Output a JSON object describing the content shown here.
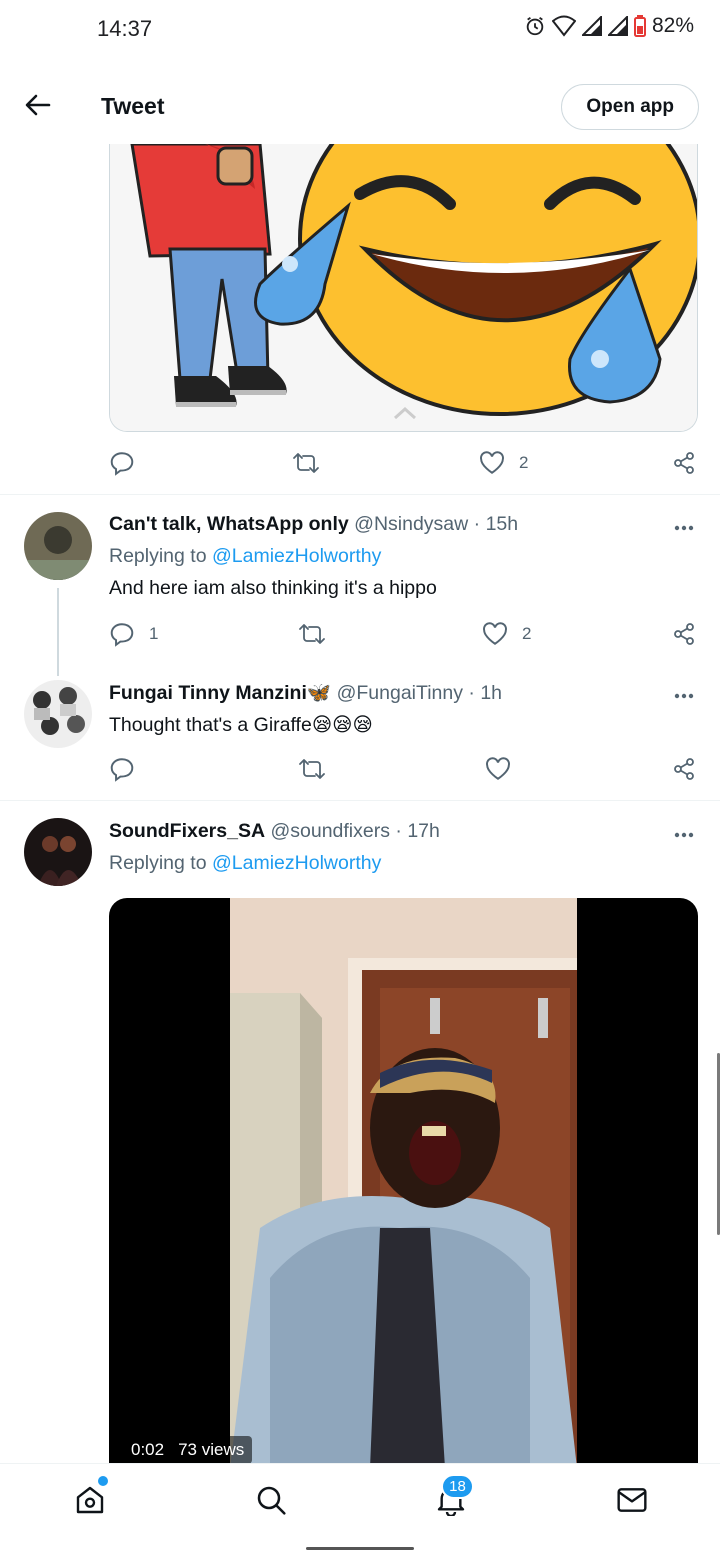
{
  "status_bar": {
    "time": "14:37",
    "battery": "82%",
    "icons": [
      "alarm-icon",
      "wifi-icon",
      "signal-icon",
      "signal-icon",
      "battery-icon"
    ]
  },
  "header": {
    "title": "Tweet",
    "open_app_label": "Open app"
  },
  "top_tweet_actions": {
    "reply_count": "",
    "retweet_count": "",
    "like_count": "2"
  },
  "replies": [
    {
      "name": "Can't talk, WhatsApp only",
      "handle": "@Nsindysaw",
      "time": "· 15h",
      "replying_prefix": "Replying to ",
      "replying_to": "@LamiezHolworthy",
      "text": "And here iam also thinking it's a hippo",
      "reply_count": "1",
      "retweet_count": "",
      "like_count": "2"
    },
    {
      "name": "Fungai Tinny Manzini🦋",
      "handle": "@FungaiTinny",
      "time": "· 1h",
      "text": "Thought that's a Giraffe😪😪😪",
      "reply_count": "",
      "retweet_count": "",
      "like_count": ""
    },
    {
      "name": "SoundFixers_SA",
      "handle": "@soundfixers",
      "time": "· 17h",
      "replying_prefix": "Replying to ",
      "replying_to": "@LamiezHolworthy",
      "video_time": "0:02",
      "video_views": "73 views"
    }
  ],
  "bottom_nav": {
    "notifications_badge": "18",
    "items": [
      "home-icon",
      "search-icon",
      "notifications-icon",
      "messages-icon"
    ]
  },
  "colors": {
    "accent": "#1d9bf0",
    "text": "#0f1419",
    "muted": "#536471",
    "border": "#cfd9de"
  }
}
